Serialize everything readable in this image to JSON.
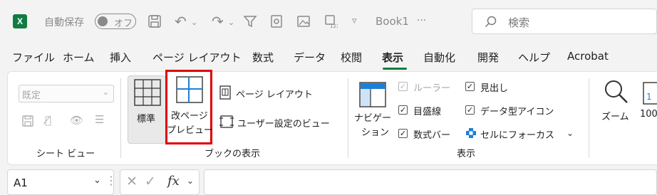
{
  "titlebar": {
    "app_icon_letter": "X",
    "autosave_label": "自動保存",
    "autosave_toggle": "オフ",
    "doc_name": "Book1",
    "doc_more": "···",
    "search_placeholder": "検索"
  },
  "menu": {
    "tabs": [
      "ファイル",
      "ホーム",
      "挿入",
      "ページ レイアウト",
      "数式",
      "データ",
      "校閲",
      "表示",
      "自動化",
      "開発",
      "ヘルプ",
      "Acrobat"
    ],
    "active_tab": "表示"
  },
  "ribbon": {
    "sheet_view": {
      "dropdown_value": "既定",
      "group_label": "シート ビュー"
    },
    "workbook_views": {
      "normal": "標準",
      "page_break_line1": "改ページ",
      "page_break_line2": "プレビュー",
      "page_layout": "ページ レイアウト",
      "custom_views": "ユーザー設定のビュー",
      "group_label": "ブックの表示"
    },
    "show": {
      "navigation_line1": "ナビゲー",
      "navigation_line2": "ション",
      "ruler": "ルーラー",
      "gridlines": "目盛線",
      "formula_bar": "数式バー",
      "headings": "見出し",
      "data_type_icons": "データ型アイコン",
      "focus_cell": "セルにフォーカス",
      "group_label": "表示"
    },
    "zoom": {
      "zoom": "ズーム",
      "zoom_100": "100"
    }
  },
  "formula_bar": {
    "name_box": "A1",
    "fx": "fx"
  },
  "colors": {
    "excel_green": "#107c41",
    "highlight_red": "#e00000"
  }
}
